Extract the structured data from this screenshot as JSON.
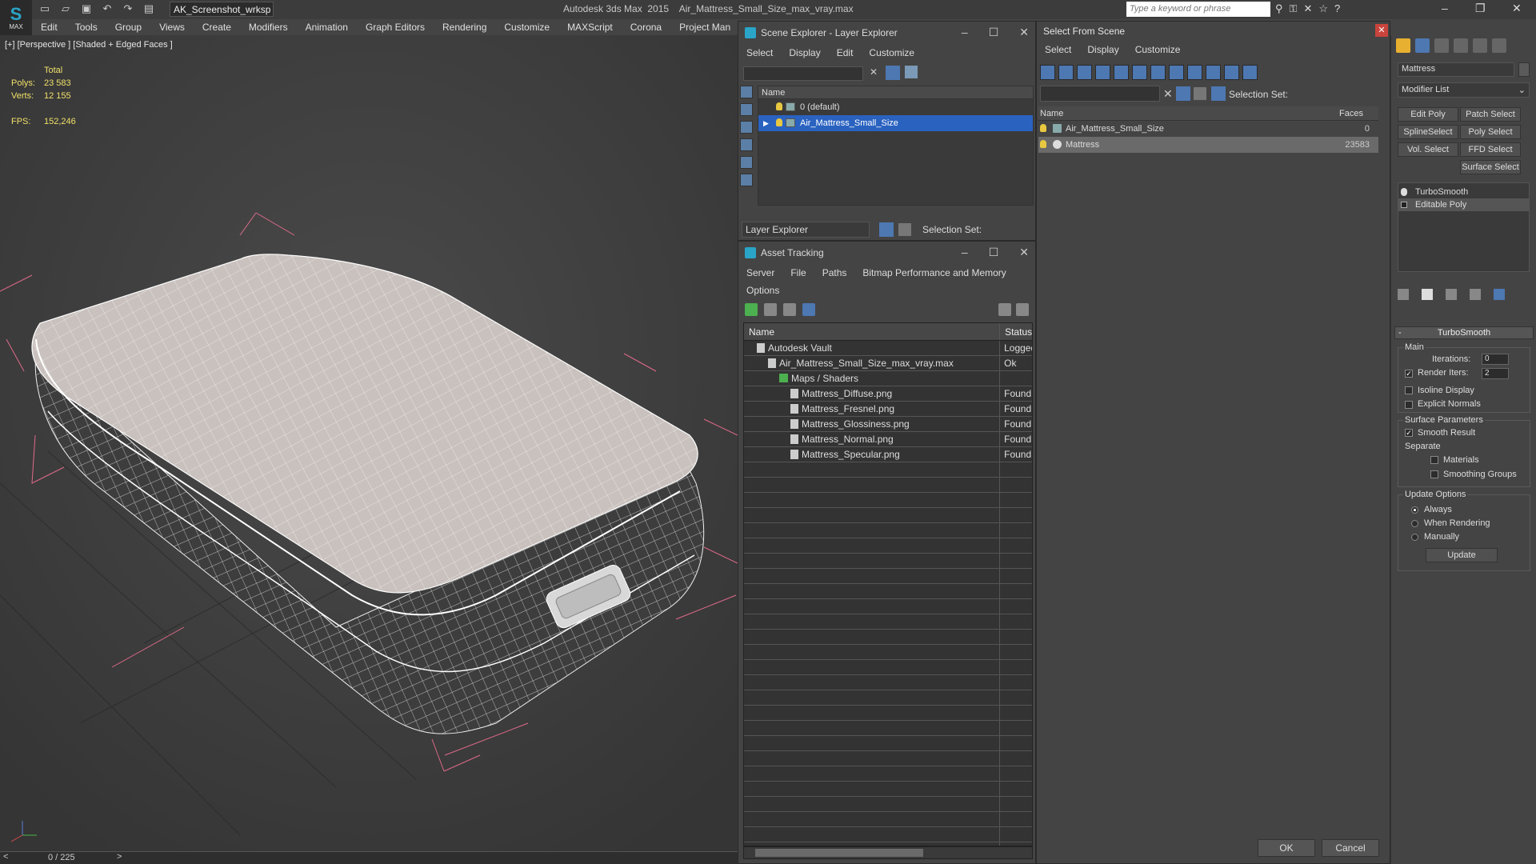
{
  "app": {
    "logo_text": "MAX",
    "workspace": "AK_Screenshot_wrksp",
    "title": "Autodesk 3ds Max  2015    Air_Mattress_Small_Size_max_vray.max",
    "search_placeholder": "Type a keyword or phrase"
  },
  "menu": [
    "Edit",
    "Tools",
    "Group",
    "Views",
    "Create",
    "Modifiers",
    "Animation",
    "Graph Editors",
    "Rendering",
    "Customize",
    "MAXScript",
    "Corona",
    "Project Man"
  ],
  "viewport": {
    "label": "[+] [Perspective ] [Shaded + Edged Faces ]",
    "stats": {
      "total_label": "Total",
      "polys_label": "Polys:",
      "polys": "23 583",
      "verts_label": "Verts:",
      "verts": "12 155",
      "fps_label": "FPS:",
      "fps": "152,246"
    }
  },
  "timeline": {
    "frame": "0 / 225"
  },
  "scene_explorer": {
    "title": "Scene Explorer - Layer Explorer",
    "menu": [
      "Select",
      "Display",
      "Edit",
      "Customize"
    ],
    "col_name": "Name",
    "rows": [
      "0 (default)",
      "Air_Mattress_Small_Size"
    ],
    "footer_dropdown": "Layer Explorer",
    "selection_set": "Selection Set:"
  },
  "asset_tracking": {
    "title": "Asset Tracking",
    "menu": [
      "Server",
      "File",
      "Paths",
      "Bitmap Performance and Memory"
    ],
    "menu2": "Options",
    "col_name": "Name",
    "col_status": "Status",
    "rows": [
      {
        "name": "Autodesk Vault",
        "status": "Logged"
      },
      {
        "name": "Air_Mattress_Small_Size_max_vray.max",
        "status": "Ok"
      },
      {
        "name": "Maps / Shaders",
        "status": ""
      },
      {
        "name": "Mattress_Diffuse.png",
        "status": "Found"
      },
      {
        "name": "Mattress_Fresnel.png",
        "status": "Found"
      },
      {
        "name": "Mattress_Glossiness.png",
        "status": "Found"
      },
      {
        "name": "Mattress_Normal.png",
        "status": "Found"
      },
      {
        "name": "Mattress_Specular.png",
        "status": "Found"
      }
    ]
  },
  "select_from_scene": {
    "title": "Select From Scene",
    "menu": [
      "Select",
      "Display",
      "Customize"
    ],
    "selection_set": "Selection Set:",
    "col_name": "Name",
    "col_faces": "Faces",
    "rows": [
      {
        "name": "Air_Mattress_Small_Size",
        "faces": "0"
      },
      {
        "name": "Mattress",
        "faces": "23583"
      }
    ],
    "ok": "OK",
    "cancel": "Cancel"
  },
  "command_panel": {
    "object_name": "Mattress",
    "modifier_list": "Modifier List",
    "buttons": [
      "Edit Poly",
      "Patch Select",
      "SplineSelect",
      "Poly Select",
      "Vol. Select",
      "FFD Select",
      "Surface Select"
    ],
    "stack": [
      "TurboSmooth",
      "Editable Poly"
    ],
    "rollout_title": "TurboSmooth",
    "main_label": "Main",
    "iterations_label": "Iterations:",
    "iterations": "0",
    "render_iters_label": "Render Iters:",
    "render_iters": "2",
    "isoline_display": "Isoline Display",
    "explicit_normals": "Explicit Normals",
    "surface_params": "Surface Parameters",
    "smooth_result": "Smooth Result",
    "separate": "Separate",
    "materials": "Materials",
    "smoothing_groups": "Smoothing Groups",
    "update_options": "Update Options",
    "always": "Always",
    "when_rendering": "When Rendering",
    "manually": "Manually",
    "update_btn": "Update"
  }
}
